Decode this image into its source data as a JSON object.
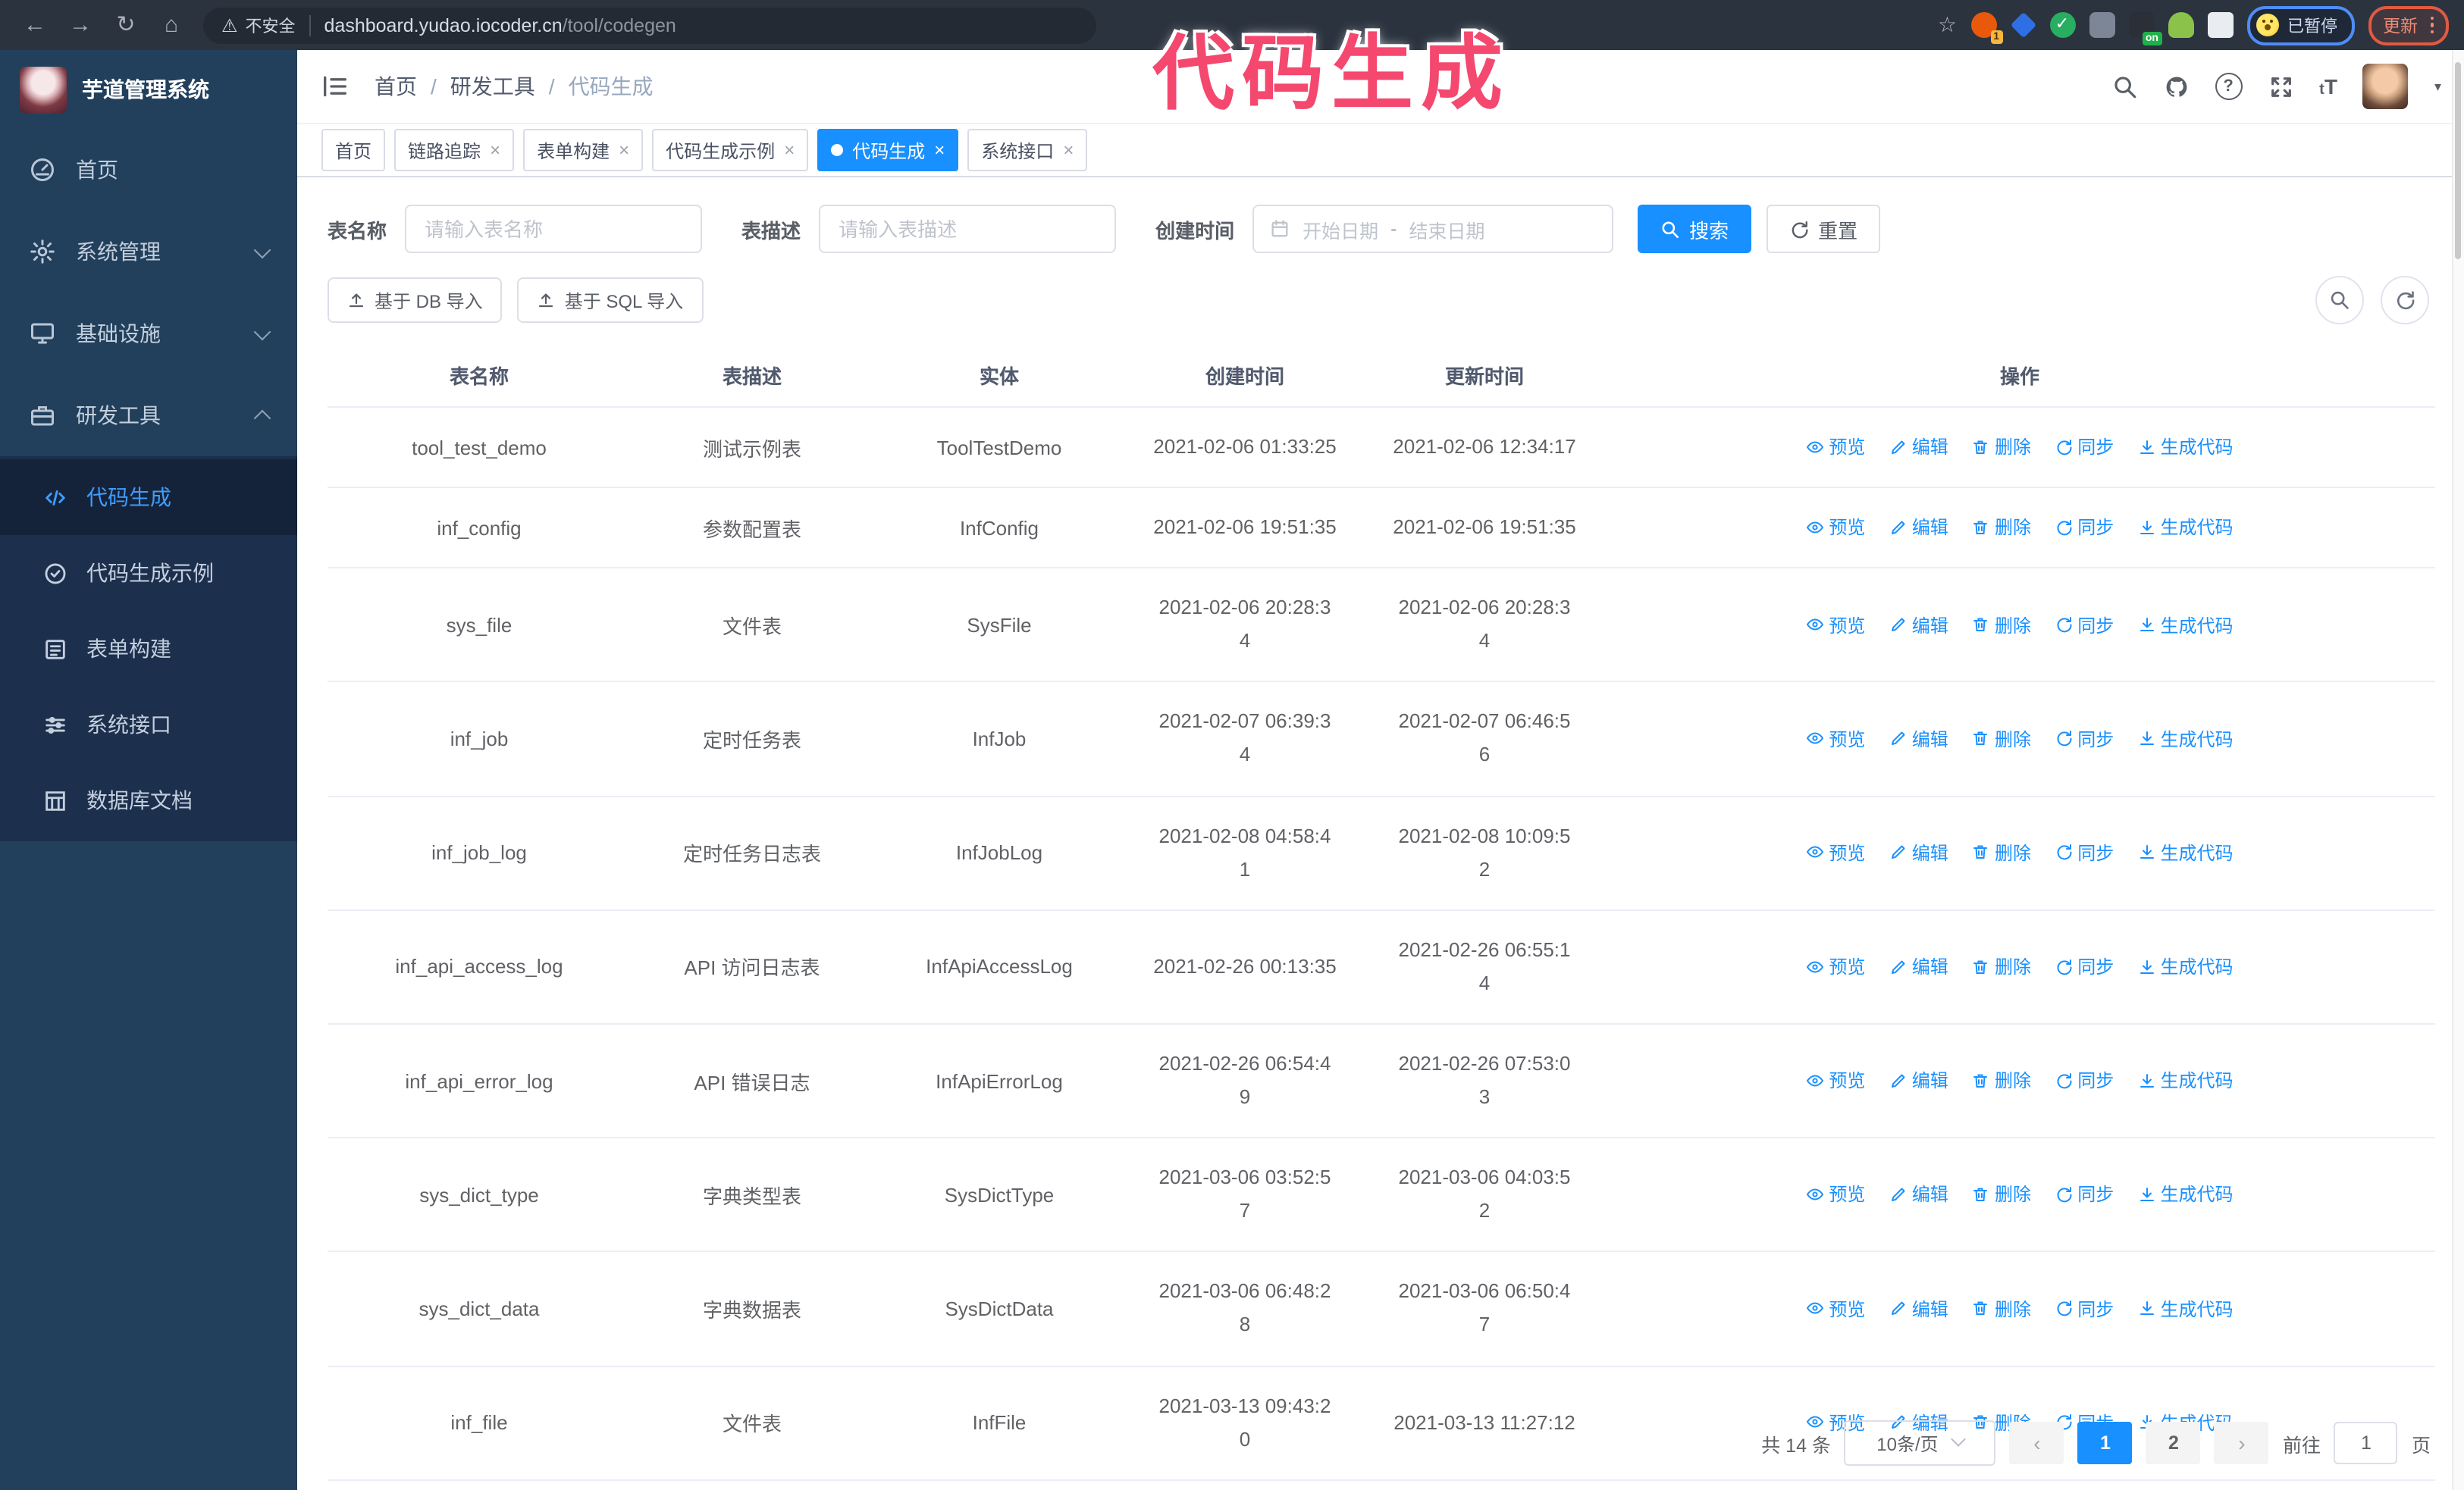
{
  "annotation": {
    "text": "代码生成",
    "color": "#f4486f"
  },
  "browser": {
    "security_label": "不安全",
    "url_host": "dashboard.yudao.iocoder.cn",
    "url_path": "/tool/codegen",
    "profile_label": "已暂停",
    "update_label": "更新",
    "extension_badge_count": "1",
    "extension_on_label": "on"
  },
  "sidebar": {
    "app_title": "芋道管理系统",
    "menu": [
      {
        "label": "首页"
      },
      {
        "label": "系统管理"
      },
      {
        "label": "基础设施"
      },
      {
        "label": "研发工具"
      }
    ],
    "submenu": [
      {
        "label": "代码生成"
      },
      {
        "label": "代码生成示例"
      },
      {
        "label": "表单构建"
      },
      {
        "label": "系统接口"
      },
      {
        "label": "数据库文档"
      }
    ]
  },
  "breadcrumb": {
    "items": [
      "首页",
      "研发工具",
      "代码生成"
    ],
    "separator": "/"
  },
  "tabs": [
    {
      "label": "首页"
    },
    {
      "label": "链路追踪"
    },
    {
      "label": "表单构建"
    },
    {
      "label": "代码生成示例"
    },
    {
      "label": "代码生成"
    },
    {
      "label": "系统接口"
    }
  ],
  "filters": {
    "name_label": "表名称",
    "name_placeholder": "请输入表名称",
    "desc_label": "表描述",
    "desc_placeholder": "请输入表描述",
    "time_label": "创建时间",
    "start_placeholder": "开始日期",
    "range_separator": "-",
    "end_placeholder": "结束日期",
    "search_label": "搜索",
    "reset_label": "重置"
  },
  "toolbar": {
    "import_db_label": "基于 DB 导入",
    "import_sql_label": "基于 SQL 导入"
  },
  "table": {
    "columns": [
      "表名称",
      "表描述",
      "实体",
      "创建时间",
      "更新时间",
      "操作"
    ],
    "actions": [
      "预览",
      "编辑",
      "删除",
      "同步",
      "生成代码"
    ],
    "rows": [
      {
        "name": "tool_test_demo",
        "desc": "测试示例表",
        "entity": "ToolTestDemo",
        "created": "2021-02-06 01:33:25",
        "updated": "2021-02-06 12:34:17"
      },
      {
        "name": "inf_config",
        "desc": "参数配置表",
        "entity": "InfConfig",
        "created": "2021-02-06 19:51:35",
        "updated": "2021-02-06 19:51:35"
      },
      {
        "name": "sys_file",
        "desc": "文件表",
        "entity": "SysFile",
        "created": "2021-02-06 20:28:3\n4",
        "updated": "2021-02-06 20:28:3\n4"
      },
      {
        "name": "inf_job",
        "desc": "定时任务表",
        "entity": "InfJob",
        "created": "2021-02-07 06:39:3\n4",
        "updated": "2021-02-07 06:46:5\n6"
      },
      {
        "name": "inf_job_log",
        "desc": "定时任务日志表",
        "entity": "InfJobLog",
        "created": "2021-02-08 04:58:4\n1",
        "updated": "2021-02-08 10:09:5\n2"
      },
      {
        "name": "inf_api_access_log",
        "desc": "API 访问日志表",
        "entity": "InfApiAccessLog",
        "created": "2021-02-26 00:13:35",
        "updated": "2021-02-26 06:55:1\n4"
      },
      {
        "name": "inf_api_error_log",
        "desc": "API 错误日志",
        "entity": "InfApiErrorLog",
        "created": "2021-02-26 06:54:4\n9",
        "updated": "2021-02-26 07:53:0\n3"
      },
      {
        "name": "sys_dict_type",
        "desc": "字典类型表",
        "entity": "SysDictType",
        "created": "2021-03-06 03:52:5\n7",
        "updated": "2021-03-06 04:03:5\n2"
      },
      {
        "name": "sys_dict_data",
        "desc": "字典数据表",
        "entity": "SysDictData",
        "created": "2021-03-06 06:48:2\n8",
        "updated": "2021-03-06 06:50:4\n7"
      },
      {
        "name": "inf_file",
        "desc": "文件表",
        "entity": "InfFile",
        "created": "2021-03-13 09:43:2\n0",
        "updated": "2021-03-13 11:27:12"
      }
    ]
  },
  "pagination": {
    "total": "共 14 条",
    "page_size": "10条/页",
    "page1": "1",
    "page2": "2",
    "active_page": "1",
    "goto_label": "前往",
    "goto_value": "1",
    "goto_suffix": "页"
  },
  "colors": {
    "accent": "#1890ff",
    "active_menu_link": "#409eff",
    "sidebar_bg": "#22405c",
    "submenu_bg": "#1c2f4d",
    "chrome_bg": "#2b333f",
    "annotation_pink": "#f4486f"
  },
  "icons": {
    "chrome": [
      "back-arrow",
      "forward-arrow",
      "reload",
      "home",
      "warning-triangle",
      "star"
    ],
    "navbar": [
      "hamburger",
      "search",
      "github",
      "help",
      "fullscreen",
      "font-size",
      "avatar",
      "caret-down"
    ],
    "row_actions": [
      "eye",
      "pencil",
      "trash",
      "sync",
      "download"
    ]
  }
}
